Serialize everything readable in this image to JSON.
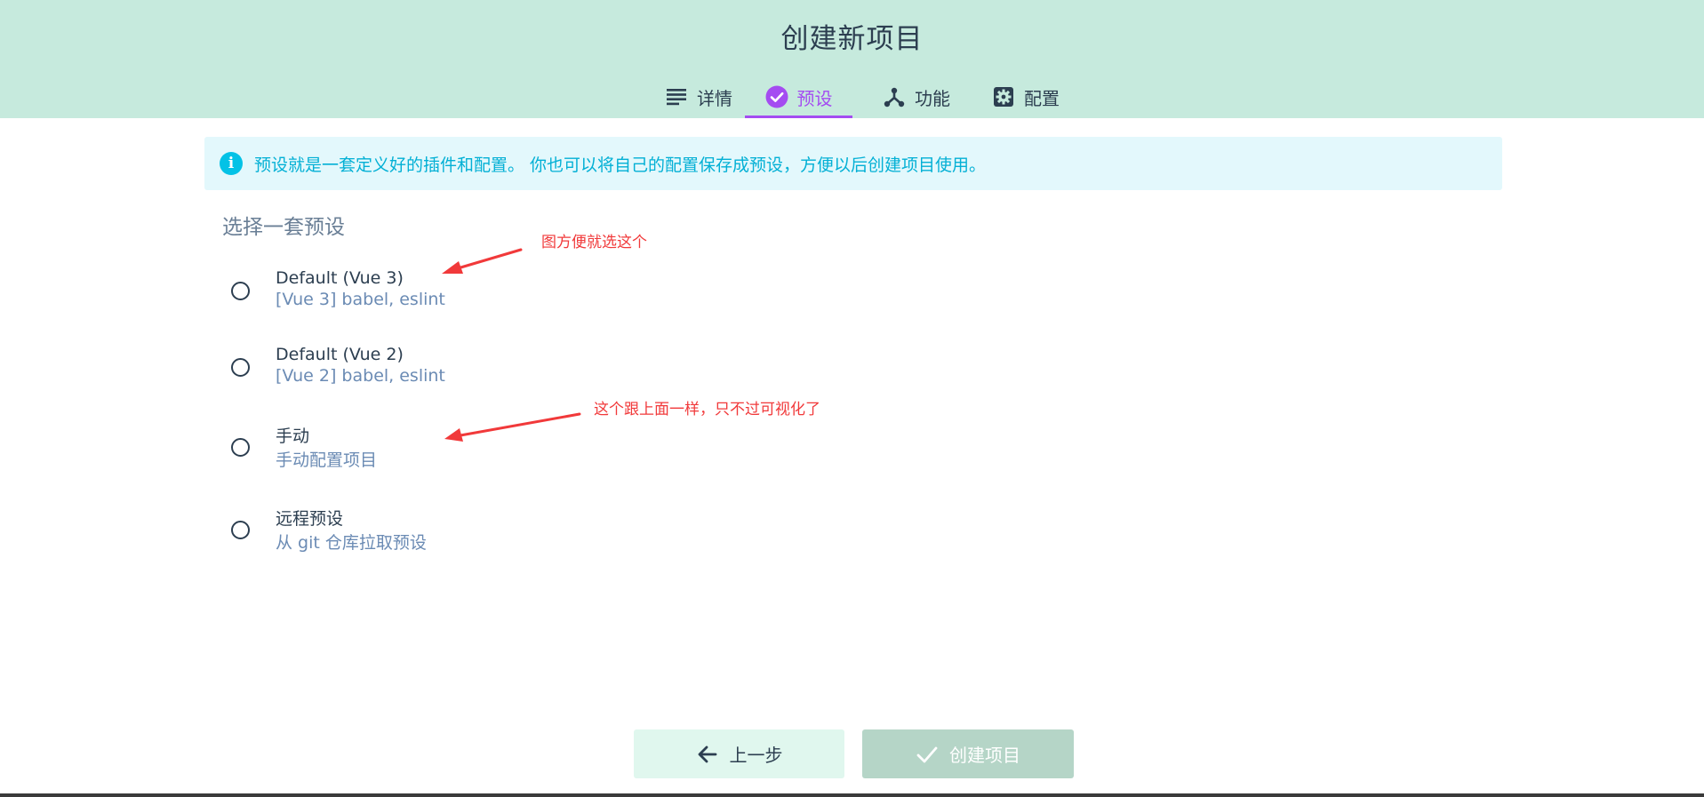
{
  "header": {
    "title": "创建新项目",
    "tabs": [
      {
        "label": "详情",
        "icon": "details-list-icon",
        "active": false
      },
      {
        "label": "预设",
        "icon": "check-circle-icon",
        "active": true
      },
      {
        "label": "功能",
        "icon": "features-fork-icon",
        "active": false
      },
      {
        "label": "配置",
        "icon": "gear-icon",
        "active": false
      }
    ]
  },
  "info": {
    "text": "预设就是一套定义好的插件和配置。 你也可以将自己的配置保存成预设，方便以后创建项目使用。",
    "icon": "info-icon"
  },
  "section": {
    "heading": "选择一套预设"
  },
  "presets": [
    {
      "name": "Default (Vue 3)",
      "desc": "[Vue 3] babel, eslint"
    },
    {
      "name": "Default (Vue 2)",
      "desc": "[Vue 2] babel, eslint"
    },
    {
      "name": "手动",
      "desc": "手动配置项目"
    },
    {
      "name": "远程预设",
      "desc": "从 git 仓库拉取预设"
    }
  ],
  "annotations": [
    {
      "text": "图方便就选这个",
      "color": "#f1393a"
    },
    {
      "text": "这个跟上面一样，只不过可视化了",
      "color": "#f1393a"
    }
  ],
  "buttons": {
    "prev_label": "上一步",
    "create_label": "创建项目"
  },
  "colors": {
    "header_bg": "#c6eadd",
    "accent": "#a44cf1",
    "info_bg": "#e3f8fc",
    "info_text": "#03b0d5"
  }
}
